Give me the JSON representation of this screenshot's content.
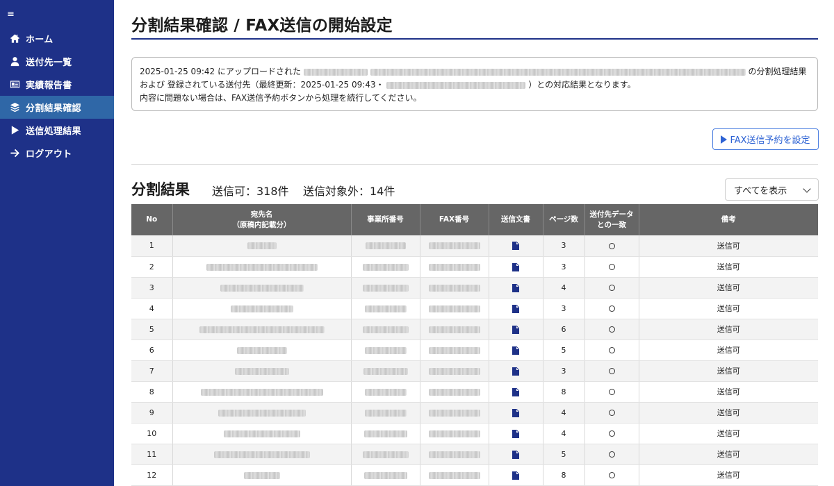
{
  "sidebar": {
    "menu_icon": "≡",
    "items": [
      {
        "label": "ホーム",
        "icon": "home-icon",
        "active": false
      },
      {
        "label": "送付先一覧",
        "icon": "user-icon",
        "active": false
      },
      {
        "label": "実績報告書",
        "icon": "id-card-icon",
        "active": false
      },
      {
        "label": "分割結果確認",
        "icon": "layers-icon",
        "active": true
      },
      {
        "label": "送信処理結果",
        "icon": "play-icon",
        "active": false
      },
      {
        "label": "ログアウト",
        "icon": "arrow-right-icon",
        "active": false
      }
    ]
  },
  "page": {
    "title": "分割結果確認 / FAX送信の開始設定"
  },
  "info": {
    "line1_prefix": "2025-01-25 09:42 にアップロードされた",
    "line1_suffix": "の分割処理結果",
    "line2_prefix": "および 登録されている送付先（最終更新：2025-01-25 09:43・",
    "line2_suffix": "）との対応結果となります。",
    "line3": "内容に問題ない場合は、FAX送信予約ボタンから処理を続行してください。"
  },
  "actions": {
    "fax_button_label": "FAX送信予約を設定"
  },
  "section": {
    "title": "分割結果",
    "sendable": "送信可：318件",
    "excluded": "送信対象外：14件"
  },
  "filter": {
    "selected": "すべてを表示"
  },
  "table": {
    "headers": {
      "no": "No",
      "name_line1": "宛先名",
      "name_line2": "（原稿内記載分）",
      "office": "事業所番号",
      "fax": "FAX番号",
      "doc": "送信文書",
      "pages": "ページ数",
      "match_line1": "送付先データ",
      "match_line2": "との一致",
      "note": "備考"
    },
    "rows": [
      {
        "no": "1",
        "pages": "3",
        "note": "送信可"
      },
      {
        "no": "2",
        "pages": "3",
        "note": "送信可"
      },
      {
        "no": "3",
        "pages": "4",
        "note": "送信可"
      },
      {
        "no": "4",
        "pages": "3",
        "note": "送信可"
      },
      {
        "no": "5",
        "pages": "6",
        "note": "送信可"
      },
      {
        "no": "6",
        "pages": "5",
        "note": "送信可"
      },
      {
        "no": "7",
        "pages": "3",
        "note": "送信可"
      },
      {
        "no": "8",
        "pages": "8",
        "note": "送信可"
      },
      {
        "no": "9",
        "pages": "4",
        "note": "送信可"
      },
      {
        "no": "10",
        "pages": "4",
        "note": "送信可"
      },
      {
        "no": "11",
        "pages": "5",
        "note": "送信可"
      },
      {
        "no": "12",
        "pages": "8",
        "note": "送信可"
      }
    ]
  }
}
